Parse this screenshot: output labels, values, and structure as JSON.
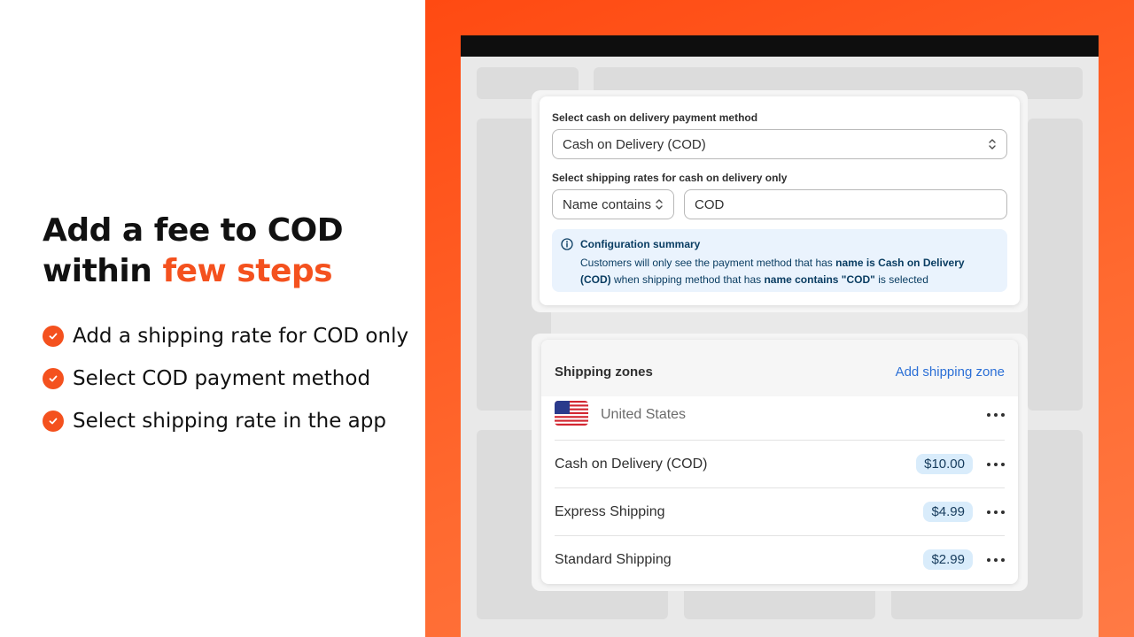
{
  "left": {
    "headline_line1": "Add a fee to COD",
    "headline_line2_prefix": "within ",
    "headline_line2_accent": "few steps",
    "steps": [
      "Add a shipping rate for COD only",
      "Select COD payment method",
      "Select shipping rate in the app"
    ]
  },
  "config": {
    "payment_label": "Select cash on delivery payment method",
    "payment_value": "Cash on Delivery (COD)",
    "rates_label": "Select shipping rates for cash on delivery only",
    "condition_value": "Name contains",
    "condition_text": "COD",
    "summary_title": "Configuration summary",
    "summary_part1": "Customers will only see the payment method that has ",
    "summary_bold1": "name is Cash on Delivery (COD)",
    "summary_part2": " when shipping method that has ",
    "summary_bold2": "name contains \"COD\"",
    "summary_part3": " is selected"
  },
  "zones": {
    "title": "Shipping zones",
    "add_label": "Add shipping zone",
    "country": "United States",
    "rates": [
      {
        "name": "Cash on Delivery (COD)",
        "price": "$10.00"
      },
      {
        "name": "Express Shipping",
        "price": "$4.99"
      },
      {
        "name": "Standard Shipping",
        "price": "$2.99"
      }
    ]
  },
  "colors": {
    "accent": "#f4511e",
    "link": "#2b6fd6",
    "summary_bg": "#eaf3fd",
    "price_bg": "#d9ecfb"
  },
  "icons": {
    "step": "check-circle-icon",
    "info": "info-circle-icon",
    "select": "chevron-up-down-icon",
    "more": "more-horizontal-icon",
    "flag": "us-flag-icon"
  }
}
